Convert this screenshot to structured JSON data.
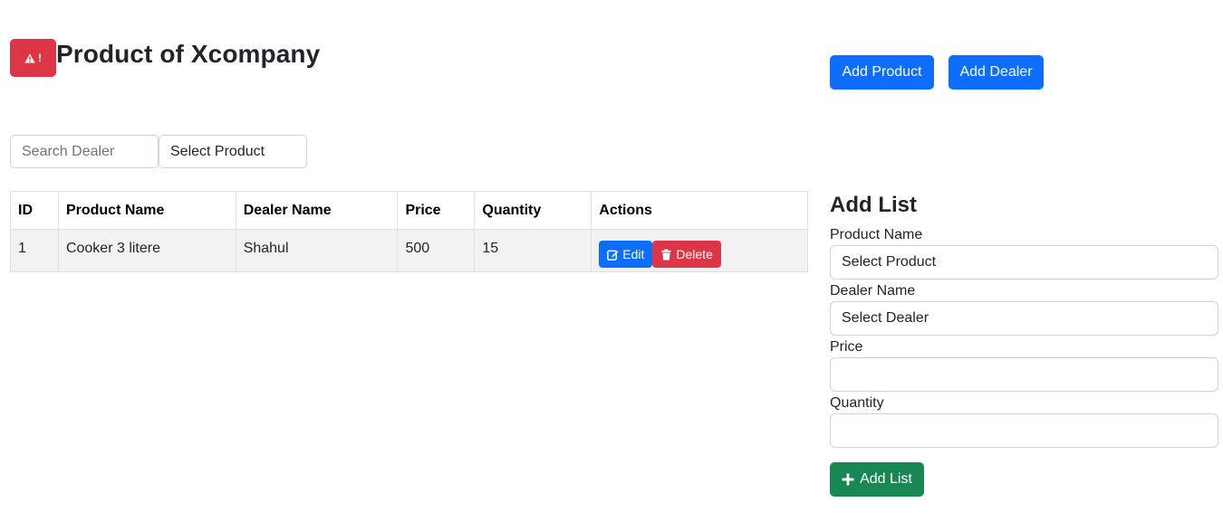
{
  "header": {
    "alert_icon_text": "!",
    "title": "Product of Xcompany"
  },
  "toolbar": {
    "add_product_label": "Add Product",
    "add_dealer_label": "Add Dealer"
  },
  "filters": {
    "search_placeholder": "Search Dealer",
    "select_product_value": "Select Product"
  },
  "table": {
    "headers": [
      "ID",
      "Product Name",
      "Dealer Name",
      "Price",
      "Quantity",
      "Actions"
    ],
    "rows": [
      {
        "id": "1",
        "product_name": "Cooker 3 litere",
        "dealer_name": "Shahul",
        "price": "500",
        "quantity": "15",
        "edit_label": "Edit",
        "delete_label": "Delete"
      }
    ]
  },
  "form": {
    "title": "Add List",
    "product_label": "Product Name",
    "product_value": "Select Product",
    "dealer_label": "Dealer Name",
    "dealer_value": "Select Dealer",
    "price_label": "Price",
    "price_value": "",
    "quantity_label": "Quantity",
    "quantity_value": "",
    "submit_label": "Add List"
  },
  "colors": {
    "primary": "#0d6efd",
    "danger": "#dc3545",
    "success": "#198754"
  }
}
